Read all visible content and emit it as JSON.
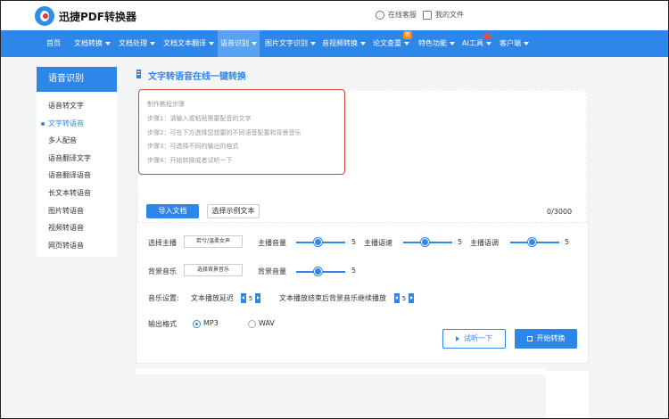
{
  "header": {
    "brand": "迅捷PDF转换器",
    "online_service": "在线客服",
    "my_files": "我的文件"
  },
  "nav": [
    {
      "label": "首页",
      "caret": false
    },
    {
      "label": "文档转换",
      "caret": true
    },
    {
      "label": "文档处理",
      "caret": true
    },
    {
      "label": "文档文本翻译",
      "caret": true
    },
    {
      "label": "语音识别",
      "caret": true
    },
    {
      "label": "图片文字识别",
      "caret": true
    },
    {
      "label": "音视频转换",
      "caret": true
    },
    {
      "label": "论文查重",
      "caret": true
    },
    {
      "label": "特色功能",
      "caret": true
    },
    {
      "label": "AI工具",
      "caret": true
    },
    {
      "label": "客户端",
      "caret": true
    }
  ],
  "nav_badge_new": "新",
  "sidebar": {
    "title": "语音识别",
    "items": [
      {
        "label": "语音转文字",
        "active": false
      },
      {
        "label": "文字转语音",
        "active": true
      },
      {
        "label": "多人配音",
        "active": false
      },
      {
        "label": "语音翻译文字",
        "active": false
      },
      {
        "label": "语音翻译语音",
        "active": false
      },
      {
        "label": "长文本转语音",
        "active": false
      },
      {
        "label": "图片转语音",
        "active": false
      },
      {
        "label": "视频转语音",
        "active": false
      },
      {
        "label": "网页转语音",
        "active": false
      }
    ]
  },
  "main": {
    "title": "文字转语音在线一键转换",
    "tutorial": [
      "制作教程步骤",
      "步骤1：请输入或粘贴需要配音的文字",
      "步骤2：可在下方选择您想要的不同语音配置和背景音乐",
      "步骤3：可选择不同的输出的格式",
      "步骤4：开始转换或者试听一下"
    ],
    "import_button": "导入文档",
    "sample_button": "选择示例文本",
    "char_count": "0/3000"
  },
  "settings": {
    "anchor_label": "选择主播",
    "anchor_value": "若兮/温柔女声",
    "volume_label": "主播音量",
    "volume_value": "5",
    "speed_label": "主播语速",
    "speed_value": "5",
    "pitch_label": "主播语调",
    "pitch_value": "5",
    "bgm_label": "背景音乐",
    "bgm_button": "选择背景音乐",
    "bgm_volume_label": "背景音量",
    "bgm_volume_value": "5",
    "music_settings_label": "音乐设置:",
    "delay_label": "文本播放延迟",
    "delay_value": "5",
    "continue_label": "文本播放结束后背景音乐继续播放",
    "continue_value": "5",
    "format_label": "输出格式",
    "formats": [
      {
        "label": "MP3",
        "selected": true
      },
      {
        "label": "WAV",
        "selected": false
      }
    ],
    "listen_button": "试听一下",
    "start_button": "开始转换"
  },
  "colors": {
    "accent": "#2e86e8",
    "highlight_border": "#d9423a"
  }
}
